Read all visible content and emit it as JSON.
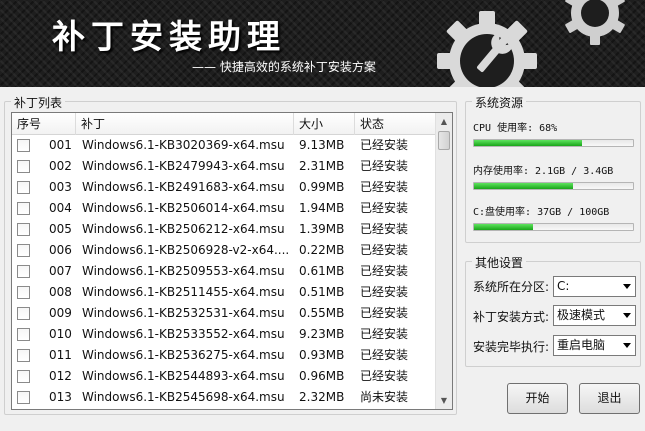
{
  "header": {
    "title": "补丁安装助理",
    "subtitle": "—— 快捷高效的系统补丁安装方案",
    "graphic": "gear-wrench-icon"
  },
  "patch_list": {
    "label": "补丁列表",
    "columns": [
      "序号",
      "补丁",
      "大小",
      "状态"
    ],
    "rows": [
      {
        "no": "001",
        "name": "Windows6.1-KB3020369-x64.msu",
        "size": "9.13MB",
        "status": "已经安装"
      },
      {
        "no": "002",
        "name": "Windows6.1-KB2479943-x64.msu",
        "size": "2.31MB",
        "status": "已经安装"
      },
      {
        "no": "003",
        "name": "Windows6.1-KB2491683-x64.msu",
        "size": "0.99MB",
        "status": "已经安装"
      },
      {
        "no": "004",
        "name": "Windows6.1-KB2506014-x64.msu",
        "size": "1.94MB",
        "status": "已经安装"
      },
      {
        "no": "005",
        "name": "Windows6.1-KB2506212-x64.msu",
        "size": "1.39MB",
        "status": "已经安装"
      },
      {
        "no": "006",
        "name": "Windows6.1-KB2506928-v2-x64....",
        "size": "0.22MB",
        "status": "已经安装"
      },
      {
        "no": "007",
        "name": "Windows6.1-KB2509553-x64.msu",
        "size": "0.61MB",
        "status": "已经安装"
      },
      {
        "no": "008",
        "name": "Windows6.1-KB2511455-x64.msu",
        "size": "0.51MB",
        "status": "已经安装"
      },
      {
        "no": "009",
        "name": "Windows6.1-KB2532531-x64.msu",
        "size": "0.55MB",
        "status": "已经安装"
      },
      {
        "no": "010",
        "name": "Windows6.1-KB2533552-x64.msu",
        "size": "9.23MB",
        "status": "已经安装"
      },
      {
        "no": "011",
        "name": "Windows6.1-KB2536275-x64.msu",
        "size": "0.93MB",
        "status": "已经安装"
      },
      {
        "no": "012",
        "name": "Windows6.1-KB2544893-x64.msu",
        "size": "0.96MB",
        "status": "已经安装"
      },
      {
        "no": "013",
        "name": "Windows6.1-KB2545698-x64.msu",
        "size": "2.32MB",
        "status": "尚未安装"
      }
    ]
  },
  "resources": {
    "label": "系统资源",
    "cpu": {
      "text": "CPU 使用率: 68%",
      "fraction": 0.68
    },
    "memory": {
      "text": "内存使用率: 2.1GB / 3.4GB",
      "fraction": 0.62
    },
    "disk": {
      "text": "C:盘使用率: 37GB / 100GB",
      "fraction": 0.37
    },
    "bar_color": "#19a519"
  },
  "settings": {
    "label": "其他设置",
    "items": [
      {
        "label": "系统所在分区:",
        "value": "C:"
      },
      {
        "label": "补丁安装方式:",
        "value": "极速模式"
      },
      {
        "label": "安装完毕执行:",
        "value": "重启电脑"
      }
    ]
  },
  "buttons": {
    "start": "开始",
    "exit": "退出"
  }
}
